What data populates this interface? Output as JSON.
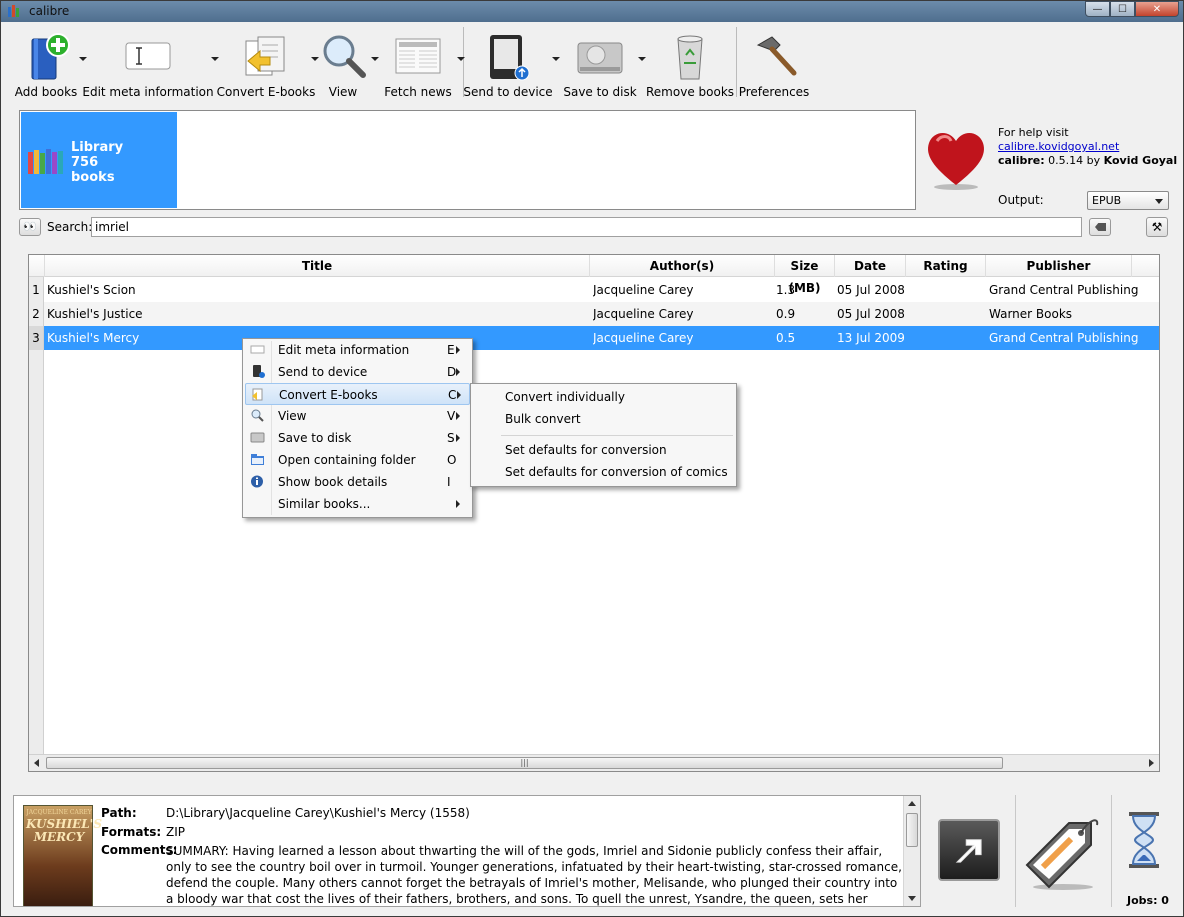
{
  "window": {
    "title": "calibre",
    "min_glyph": "—",
    "max_glyph": "☐",
    "close_glyph": "✕"
  },
  "toolbar": {
    "add_books": "Add books",
    "edit_meta": "Edit meta information",
    "convert": "Convert E-books",
    "view": "View",
    "fetch_news": "Fetch news",
    "send_to_device": "Send to device",
    "save_to_disk": "Save to disk",
    "remove_books": "Remove books",
    "preferences": "Preferences"
  },
  "library": {
    "line1": "Library",
    "line2": "756",
    "line3": "books"
  },
  "help": {
    "prefix": "For help visit ",
    "link": "calibre.kovidgoyal.net",
    "app": "calibre:",
    "version": " 0.5.14 by ",
    "author": "Kovid Goyal"
  },
  "output": {
    "label": "Output:",
    "value": "EPUB"
  },
  "search": {
    "label": "Search:",
    "value": "imriel"
  },
  "table": {
    "headers": {
      "title": "Title",
      "authors": "Author(s)",
      "size": "Size (MB)",
      "date": "Date",
      "rating": "Rating",
      "publisher": "Publisher"
    },
    "rows": [
      {
        "num": "1",
        "title": "Kushiel's Scion",
        "author": "Jacqueline Carey",
        "size": "1.3",
        "date": "05 Jul 2008",
        "rating": "",
        "publisher": "Grand Central Publishing"
      },
      {
        "num": "2",
        "title": "Kushiel's Justice",
        "author": "Jacqueline Carey",
        "size": "0.9",
        "date": "05 Jul 2008",
        "rating": "",
        "publisher": "Warner Books"
      },
      {
        "num": "3",
        "title": "Kushiel's Mercy",
        "author": "Jacqueline Carey",
        "size": "0.5",
        "date": "13 Jul 2009",
        "rating": "",
        "publisher": "Grand Central Publishing"
      }
    ],
    "scroll_grip": "|||"
  },
  "context_menu": {
    "items": [
      {
        "label": "Edit meta information",
        "key": "E",
        "icon": "edit-icon",
        "submenu": true
      },
      {
        "label": "Send to device",
        "key": "D",
        "icon": "device-icon",
        "submenu": true
      },
      {
        "label": "Convert E-books",
        "key": "C",
        "icon": "convert-icon",
        "submenu": true
      },
      {
        "label": "View",
        "key": "V",
        "icon": "view-icon",
        "submenu": true
      },
      {
        "label": "Save to disk",
        "key": "S",
        "icon": "disk-icon",
        "submenu": true
      },
      {
        "label": "Open containing folder",
        "key": "O",
        "icon": "folder-icon",
        "submenu": false
      },
      {
        "label": "Show book details",
        "key": "I",
        "icon": "info-icon",
        "submenu": false
      },
      {
        "label": "Similar books...",
        "key": "",
        "icon": "",
        "submenu": true
      }
    ]
  },
  "convert_submenu": {
    "individually": "Convert individually",
    "bulk": "Bulk convert",
    "defaults": "Set defaults for conversion",
    "defaults_comics": "Set defaults for conversion of comics"
  },
  "details": {
    "cover_author": "JACQUELINE CAREY",
    "cover_title": "KUSHIEL'S MERCY",
    "path_label": "Path:",
    "path": "D:\\Library\\Jacqueline Carey\\Kushiel's Mercy (1558)",
    "formats_label": "Formats:",
    "formats": "ZIP",
    "comments_label": "Comments:",
    "comments": "SUMMARY: Having learned a lesson about thwarting the will of the gods, Imriel and Sidonie publicly confess their affair, only to see the country boil over in turmoil. Younger generations, infatuated by their heart-twisting, star-crossed romance, defend the couple. Many others cannot forget the betrayals of Imriel's mother, Melisande, who plunged their country into a bloody war that cost the lives of their fathers, brothers, and sons. To quell the unrest, Ysandre, the queen, sets her decree. She will not divide the lovers, yet neither will she"
  },
  "jobs": {
    "label": "Jobs: 0"
  },
  "colors": {
    "selection": "#3399ff",
    "library_tile": "#3399ff"
  }
}
